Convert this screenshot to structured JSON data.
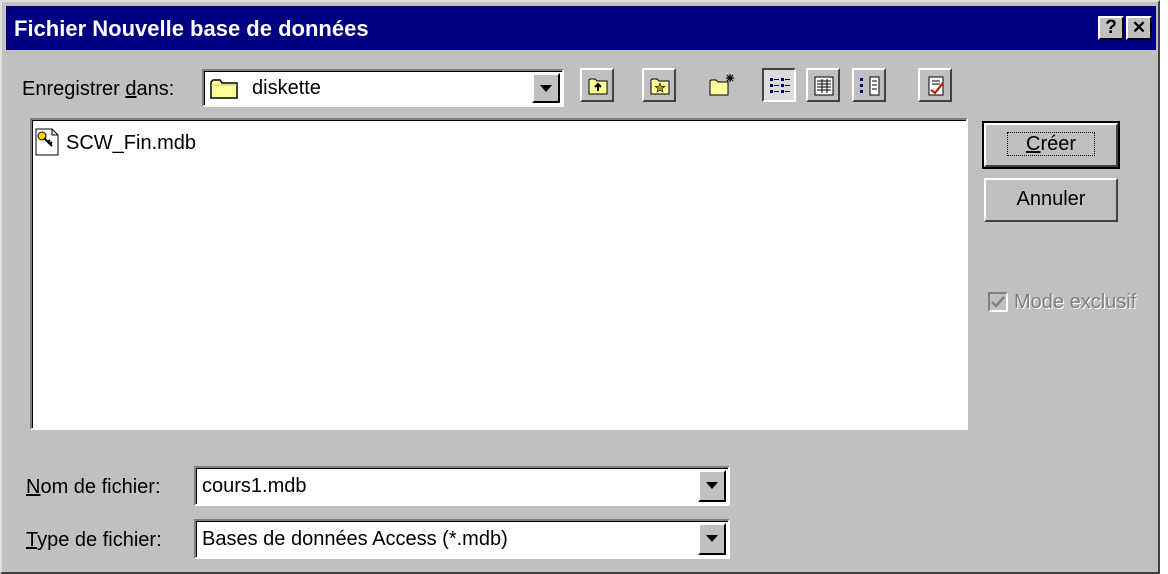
{
  "window": {
    "title": "Fichier Nouvelle base de données",
    "help_label": "?",
    "close_label": "✕"
  },
  "save_in": {
    "label_before": "Enregistrer ",
    "label_mnemonic": "d",
    "label_after": "ans:",
    "value": "diskette"
  },
  "toolbar": {
    "buttons": [
      {
        "name": "up-one-level",
        "icon": "folder-up-icon"
      },
      {
        "name": "favorites",
        "icon": "favorites-folder-icon"
      },
      {
        "name": "new-folder",
        "icon": "new-folder-icon"
      },
      {
        "name": "list-view",
        "icon": "list-view-icon",
        "pressed": true
      },
      {
        "name": "details-view",
        "icon": "details-view-icon"
      },
      {
        "name": "properties-view",
        "icon": "properties-view-icon"
      },
      {
        "name": "commands",
        "icon": "commands-icon"
      }
    ]
  },
  "files": [
    {
      "name": "SCW_Fin.mdb",
      "icon": "database-file-icon"
    }
  ],
  "buttons": {
    "create_mnemonic": "C",
    "create_rest": "réer",
    "cancel": "Annuler"
  },
  "exclusive_mode": {
    "label": "Mode exclusif",
    "checked": true,
    "disabled": true
  },
  "file_name": {
    "label_mnemonic": "N",
    "label_rest": "om de fichier:",
    "value": "cours1.mdb"
  },
  "file_type": {
    "label_mnemonic": "T",
    "label_rest": "ype de fichier:",
    "value": "Bases de données Access (*.mdb)"
  },
  "colors": {
    "title_bar": "#000080",
    "face": "#c0c0c0"
  }
}
